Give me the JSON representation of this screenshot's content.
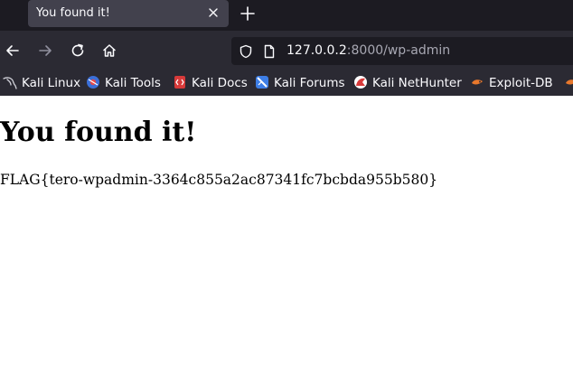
{
  "tab": {
    "title": "You found it!",
    "close_icon": "close-icon",
    "new_tab_icon": "plus-icon"
  },
  "nav": {
    "back_icon": "arrow-left-icon",
    "forward_icon": "arrow-right-icon",
    "reload_icon": "reload-icon",
    "home_icon": "home-icon"
  },
  "urlbar": {
    "host": "127.0.0.2",
    "rest": ":8000/wp-admin",
    "shield_icon": "shield-icon",
    "page_icon": "page-icon"
  },
  "bookmarks": [
    {
      "label": "Kali Linux",
      "icon": "kali-dragon-icon"
    },
    {
      "label": "Kali Tools",
      "icon": "kali-tools-icon"
    },
    {
      "label": "Kali Docs",
      "icon": "kali-docs-icon"
    },
    {
      "label": "Kali Forums",
      "icon": "kali-forums-icon"
    },
    {
      "label": "Kali NetHunter",
      "icon": "kali-nethunter-icon"
    },
    {
      "label": "Exploit-DB",
      "icon": "exploit-db-icon"
    }
  ],
  "page": {
    "heading": "You found it!",
    "flag": "FLAG{tero-wpadmin-3364c855a2ac87341fc7bcbda955b580}"
  },
  "colors": {
    "tabstrip": "#1c1b22",
    "toolbar": "#2b2a33",
    "active_tab": "#42414d",
    "text_light": "#fbfbfe",
    "url_dim": "#a8a8b3"
  }
}
